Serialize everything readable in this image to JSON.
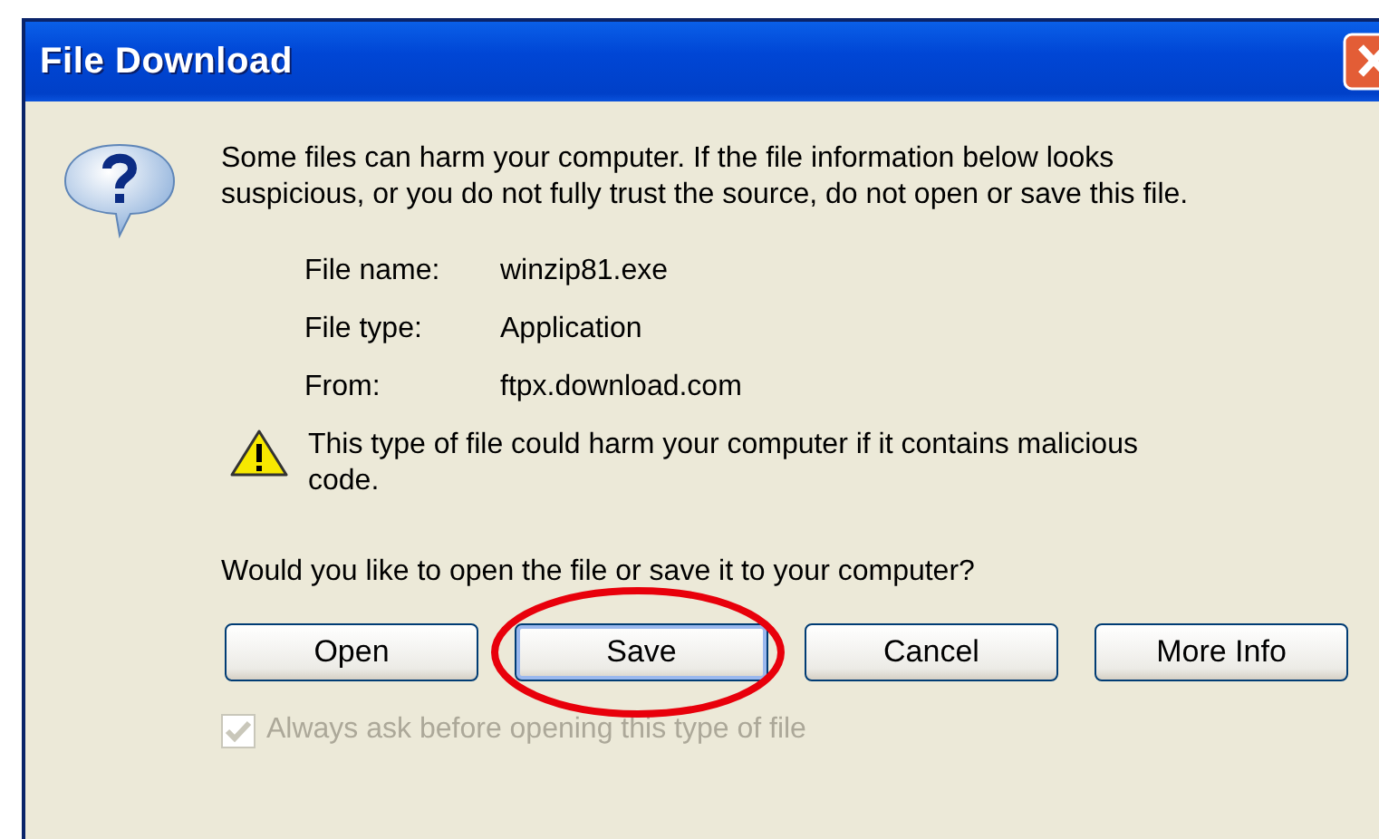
{
  "window": {
    "title": "File Download"
  },
  "message": "Some files can harm your computer. If the file information below looks suspicious, or you do not fully trust the source, do not open or save this file.",
  "file_info": [
    {
      "label": "File name:",
      "value": "winzip81.exe"
    },
    {
      "label": "File type:",
      "value": "Application"
    },
    {
      "label": "From:",
      "value": "ftpx.download.com"
    }
  ],
  "warning": "This type of file could harm your computer if it contains malicious code.",
  "question": "Would you like to open the file or save it to your computer?",
  "buttons": [
    {
      "label": "Open",
      "default": false,
      "highlighted": false
    },
    {
      "label": "Save",
      "default": true,
      "highlighted": true
    },
    {
      "label": "Cancel",
      "default": false,
      "highlighted": false
    },
    {
      "label": "More Info",
      "default": false,
      "highlighted": false
    }
  ],
  "always_ask": {
    "label": "Always ask before opening this type of file",
    "checked": true,
    "disabled": true
  }
}
